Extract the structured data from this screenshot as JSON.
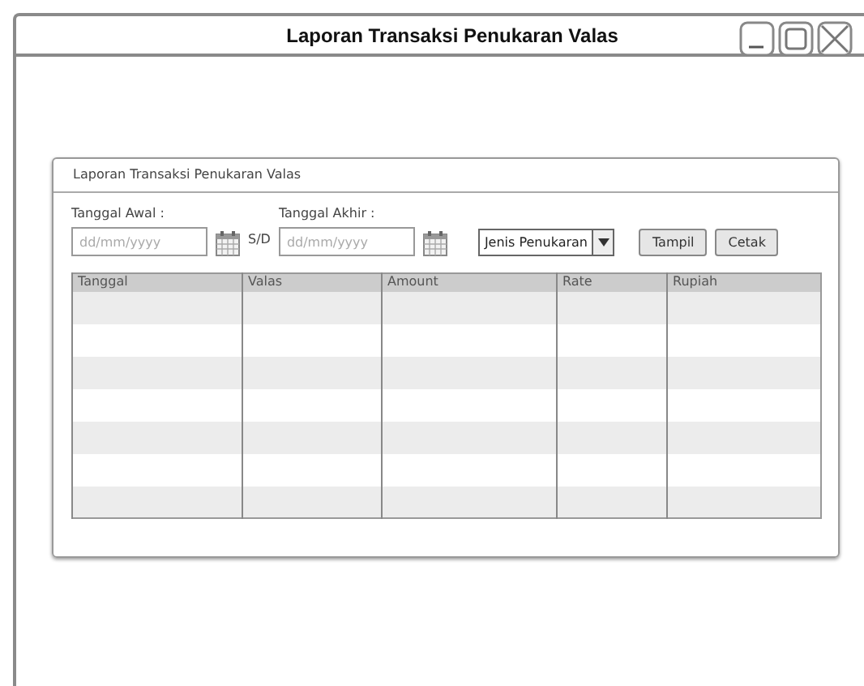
{
  "window": {
    "title": "Laporan Transaksi Penukaran Valas",
    "controls": [
      {
        "kind": "minimize"
      },
      {
        "kind": "maximize"
      },
      {
        "kind": "close"
      }
    ]
  },
  "panel": {
    "title": "Laporan Transaksi Penukaran Valas"
  },
  "filters": {
    "start_label": "Tanggal Awal :",
    "start_placeholder": "dd/mm/yyyy",
    "separator": "S/D",
    "end_label": "Tanggal Akhir :",
    "end_placeholder": "dd/mm/yyyy",
    "type_select": "Jenis Penukaran"
  },
  "buttons": [
    "Tampil",
    "Cetak"
  ],
  "table": {
    "columns": [
      "Tanggal",
      "Valas",
      "Amount",
      "Rate",
      "Rupiah"
    ]
  }
}
